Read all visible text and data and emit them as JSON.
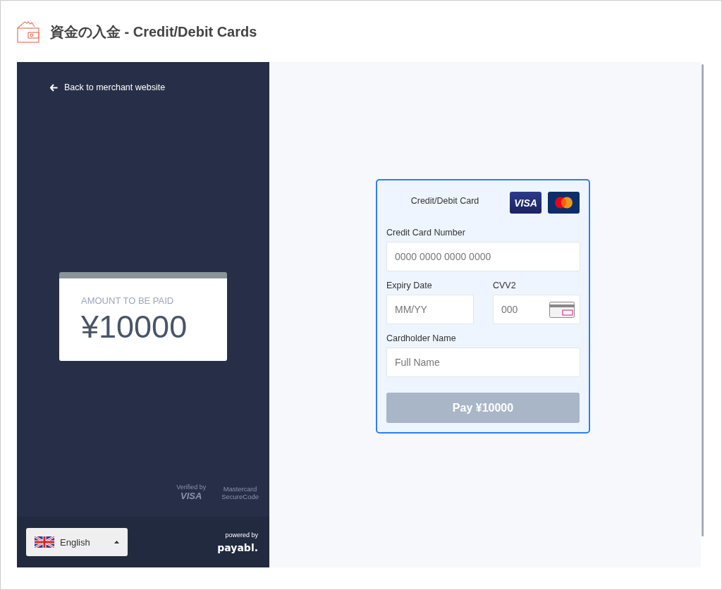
{
  "page": {
    "title": "資金の入金 - Credit/Debit Cards"
  },
  "sidebar": {
    "back_link": "Back to merchant website",
    "amount_label": "AMOUNT TO BE PAID",
    "amount": "¥10000",
    "badges": [
      {
        "kind": "visa",
        "line1": "Verified by",
        "line2": "VISA"
      },
      {
        "kind": "mastercard",
        "line1": "Mastercard",
        "line2": "SecureCode"
      }
    ],
    "language": "English",
    "powered_by": "powered by",
    "brand": "payabl."
  },
  "form": {
    "title": "Credit/Debit Card",
    "card_logos": [
      {
        "kind": "visa",
        "text": "VISA"
      },
      {
        "kind": "mastercard"
      }
    ],
    "fields": [
      {
        "label": "Credit Card Number",
        "placeholder": "0000 0000 0000 0000",
        "kind": "full"
      },
      {
        "label": "Expiry Date",
        "placeholder": "MM/YY",
        "kind": "half"
      },
      {
        "label": "CVV2",
        "placeholder": "000",
        "kind": "cvv"
      },
      {
        "label": "Cardholder Name",
        "placeholder": "Full Name",
        "kind": "full"
      }
    ],
    "pay_button": {
      "label": "Pay ¥10000",
      "disabled": true
    }
  }
}
